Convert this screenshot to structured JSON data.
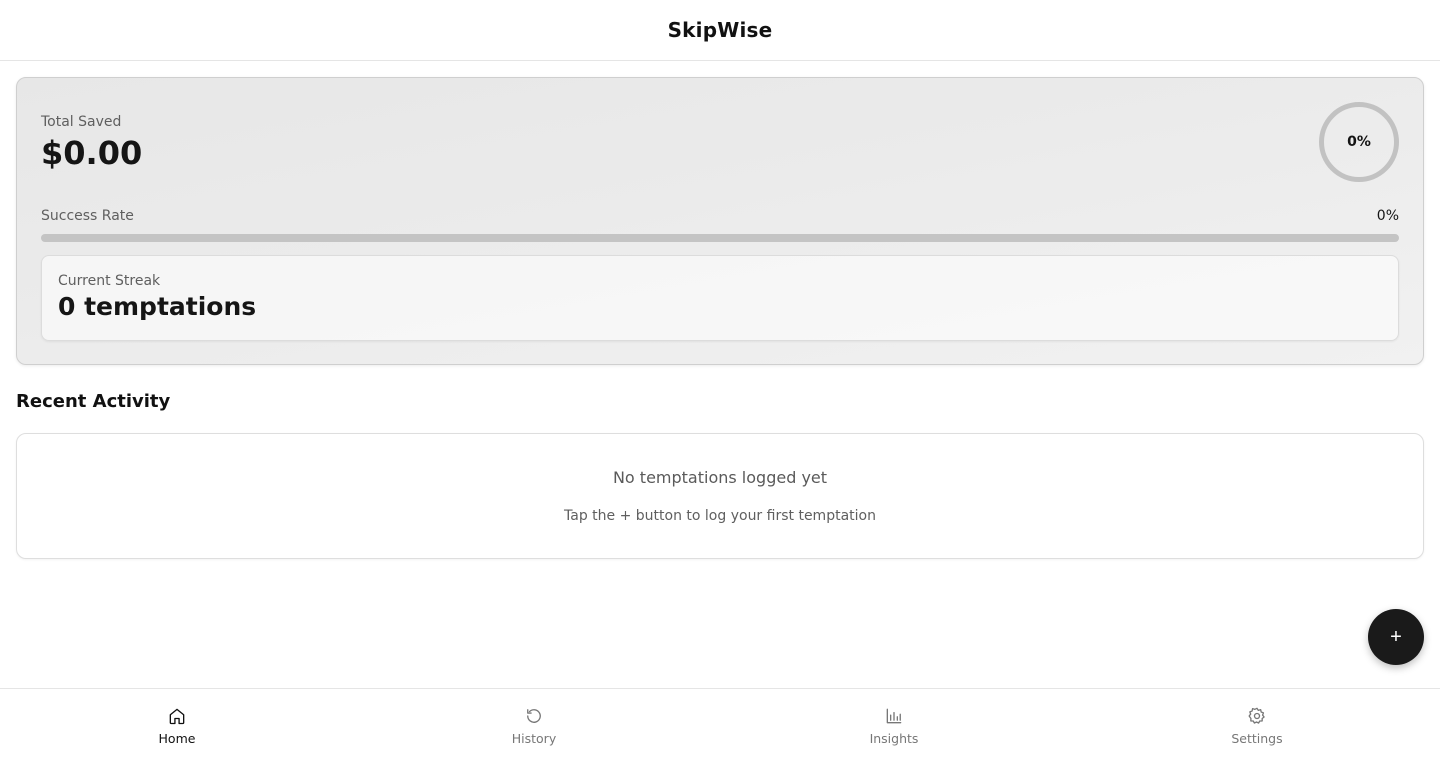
{
  "header": {
    "title": "SkipWise"
  },
  "summary": {
    "total_saved_label": "Total Saved",
    "total_saved_value": "$0.00",
    "ring_percent_text": "0%",
    "success_rate_label": "Success Rate",
    "success_rate_value": "0%",
    "success_rate_fraction": 0,
    "streak_label": "Current Streak",
    "streak_value": "0 temptations"
  },
  "recent_activity": {
    "title": "Recent Activity",
    "empty_title": "No temptations logged yet",
    "empty_subtitle": "Tap the + button to log your first temptation"
  },
  "fab": {
    "label": "+"
  },
  "nav": {
    "items": [
      {
        "label": "Home",
        "icon": "home-icon",
        "active": true
      },
      {
        "label": "History",
        "icon": "history-icon",
        "active": false
      },
      {
        "label": "Insights",
        "icon": "bar-chart-icon",
        "active": false
      },
      {
        "label": "Settings",
        "icon": "gear-icon",
        "active": false
      }
    ]
  },
  "colors": {
    "accent": "#1a1a1a",
    "card_bg": "#ebebeb",
    "muted_text": "#5f5f5f",
    "ring_track": "#c2c2c2"
  }
}
